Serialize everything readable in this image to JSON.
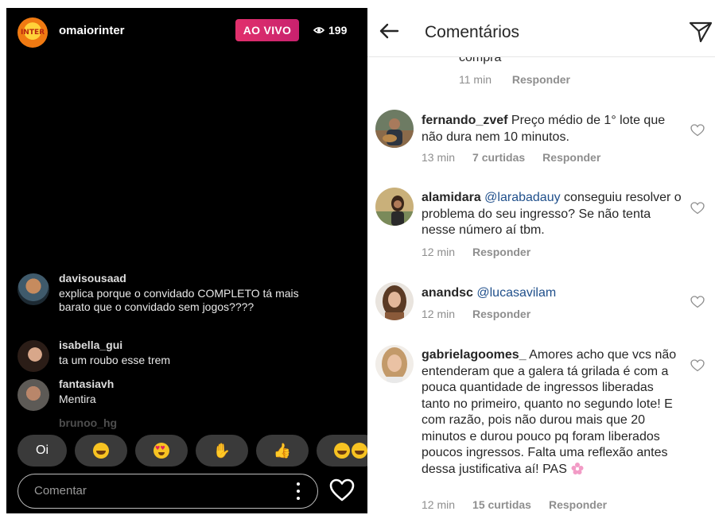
{
  "live": {
    "host": "omaiorinter",
    "host_avatar_text": "INTER",
    "badge": "AO VIVO",
    "viewers": "199",
    "comments": [
      {
        "user": "davisousaad",
        "text": "explica porque o convidado COMPLETO tá mais barato que o convidado sem jogos????"
      },
      {
        "user": "isabella_gui",
        "text": "ta um roubo esse trem"
      },
      {
        "user": "fantasiavh",
        "text": "Mentira"
      },
      {
        "user": "brunoo_hg",
        "text": ""
      }
    ],
    "quick_replies": [
      "Oi"
    ],
    "comment_placeholder": "Comentar"
  },
  "panel": {
    "title": "Comentários",
    "partial_text": "compra",
    "partial_meta": {
      "time": "11 min",
      "reply": "Responder"
    },
    "comments": [
      {
        "user": "fernando_zvef",
        "mention": "",
        "text": "Preço médio de 1° lote que não dura nem 10 minutos.",
        "time": "13 min",
        "likes": "7 curtidas",
        "reply": "Responder"
      },
      {
        "user": "alamidara",
        "mention": "@larabadauy",
        "text": "conseguiu resolver o problema do seu ingresso? Se não tenta nesse número aí tbm.",
        "time": "12 min",
        "likes": "",
        "reply": "Responder"
      },
      {
        "user": "anandsc",
        "mention": "@lucasavilam",
        "text": "",
        "time": "12 min",
        "likes": "",
        "reply": "Responder"
      },
      {
        "user": "gabrielagoomes_",
        "mention": "",
        "text": "Amores acho que vcs não entenderam que a galera tá grilada é com a pouca quantidade de ingressos liberadas tanto no primeiro, quanto no segundo lote! E com razão, pois não durou mais que 20 minutos e durou pouco pq foram liberados poucos ingressos. Falta uma reflexão antes dessa justificativa aí! PAS",
        "time": "12 min",
        "likes": "15 curtidas",
        "reply": "Responder"
      }
    ]
  },
  "colors": {
    "live_badge": "#e1306c",
    "mention": "#1f4f8b",
    "meta": "#8e8e8e"
  }
}
